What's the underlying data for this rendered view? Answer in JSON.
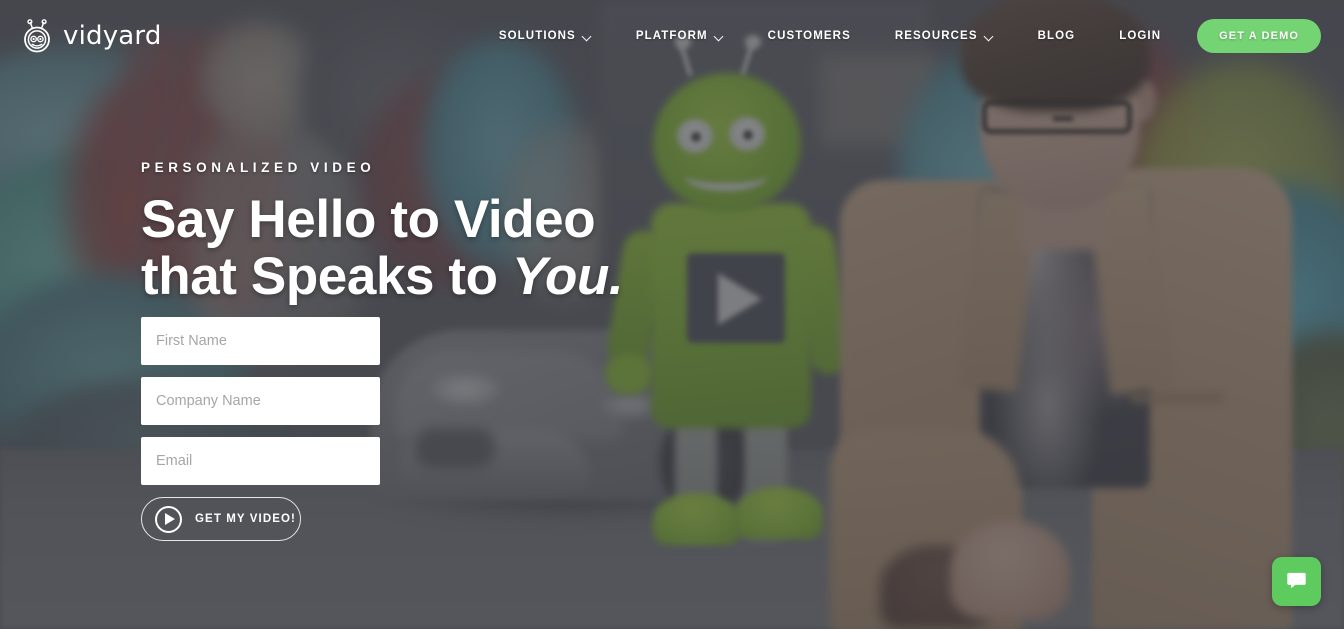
{
  "header": {
    "logo": {
      "mark_icon": "vidyard-robot-head-icon",
      "wordmark": "vidyard"
    },
    "nav": [
      {
        "label": "SOLUTIONS",
        "has_dropdown": true,
        "icon": "chevron-down-icon"
      },
      {
        "label": "PLATFORM",
        "has_dropdown": true,
        "icon": "chevron-down-icon"
      },
      {
        "label": "CUSTOMERS",
        "has_dropdown": false,
        "icon": ""
      },
      {
        "label": "RESOURCES",
        "has_dropdown": true,
        "icon": "chevron-down-icon"
      },
      {
        "label": "BLOG",
        "has_dropdown": false,
        "icon": ""
      },
      {
        "label": "LOGIN",
        "has_dropdown": false,
        "icon": ""
      }
    ],
    "demo_button": "GET A DEMO"
  },
  "hero": {
    "eyebrow": "PERSONALIZED VIDEO",
    "headline_line1": "Say Hello to Video",
    "headline_line2_plain": "that Speaks to ",
    "headline_line2_italic": "You.",
    "form": {
      "fields": [
        {
          "name": "first-name",
          "placeholder": "First Name",
          "value": ""
        },
        {
          "name": "company-name",
          "placeholder": "Company Name",
          "value": ""
        },
        {
          "name": "email",
          "placeholder": "Email",
          "value": ""
        }
      ],
      "submit_label": "GET MY VIDEO!",
      "submit_icon": "play-circle-icon"
    }
  },
  "chat_widget": {
    "icon": "chat-bubble-icon",
    "label": "Open chat"
  },
  "colors": {
    "accent_green": "#5ecb5e",
    "demo_button_green": "#74d473",
    "overlay": "#3a3c42",
    "text_white": "#ffffff",
    "field_background": "#ffffff",
    "placeholder_grey": "#a6a6a6"
  }
}
